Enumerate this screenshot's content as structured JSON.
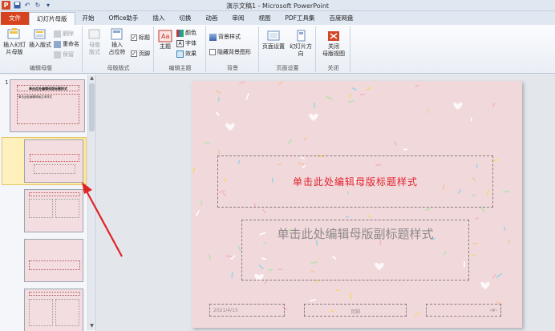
{
  "window": {
    "title": "演示文稿1 - Microsoft PowerPoint",
    "app_icon_letter": "P"
  },
  "tabs": [
    {
      "label": "文件",
      "kind": "file"
    },
    {
      "label": "幻灯片母版",
      "kind": "active"
    },
    {
      "label": "开始",
      "kind": "normal"
    },
    {
      "label": "Office助手",
      "kind": "normal"
    },
    {
      "label": "插入",
      "kind": "normal"
    },
    {
      "label": "切换",
      "kind": "normal"
    },
    {
      "label": "动画",
      "kind": "normal"
    },
    {
      "label": "审阅",
      "kind": "normal"
    },
    {
      "label": "视图",
      "kind": "normal"
    },
    {
      "label": "PDF工具集",
      "kind": "normal"
    },
    {
      "label": "百度网盘",
      "kind": "normal"
    }
  ],
  "ribbon": {
    "edit_master": {
      "label": "编辑母版",
      "insert_slide_master": "插入幻灯片母版",
      "insert_slide_master_l1": "插入幻灯",
      "insert_slide_master_l2": "片母版",
      "insert_layout": "插入版式",
      "delete": "删除",
      "rename": "重命名",
      "preserve": "保留"
    },
    "master_layout": {
      "label": "母版版式",
      "master_layout_btn_l1": "母版",
      "master_layout_btn_l2": "版式",
      "insert_placeholder_l1": "插入",
      "insert_placeholder_l2": "占位符",
      "title_check": "标题",
      "footer_check": "页脚"
    },
    "edit_theme": {
      "label": "编辑主题",
      "theme": "主题",
      "colors": "颜色",
      "fonts": "字体",
      "effects": "效果"
    },
    "background": {
      "label": "背景",
      "bg_styles": "背景样式",
      "hide_bg": "隐藏背景图形"
    },
    "page_setup": {
      "label": "页面设置",
      "page_setup_btn": "页面设置",
      "orientation": "幻灯片方向"
    },
    "close": {
      "label": "关闭",
      "close_l1": "关闭",
      "close_l2": "母版视图"
    }
  },
  "thumbnails": {
    "first_number": "1",
    "first_title": "单击此处编辑母版标题样式",
    "first_body": "单击此处编辑母版文本样式"
  },
  "slide": {
    "title_placeholder": "单击此处编辑母版标题样式",
    "subtitle_placeholder": "单击此处编辑母版副标题样式",
    "footer_date": "2021/4/15",
    "footer_center": "页脚",
    "footer_number": "‹#›"
  },
  "colors": {
    "file_tab": "#d5431f",
    "title_text": "#e0242d",
    "slide_bg": "#f1d8db",
    "selection": "#ffe7a0",
    "arrow": "#e02424"
  }
}
